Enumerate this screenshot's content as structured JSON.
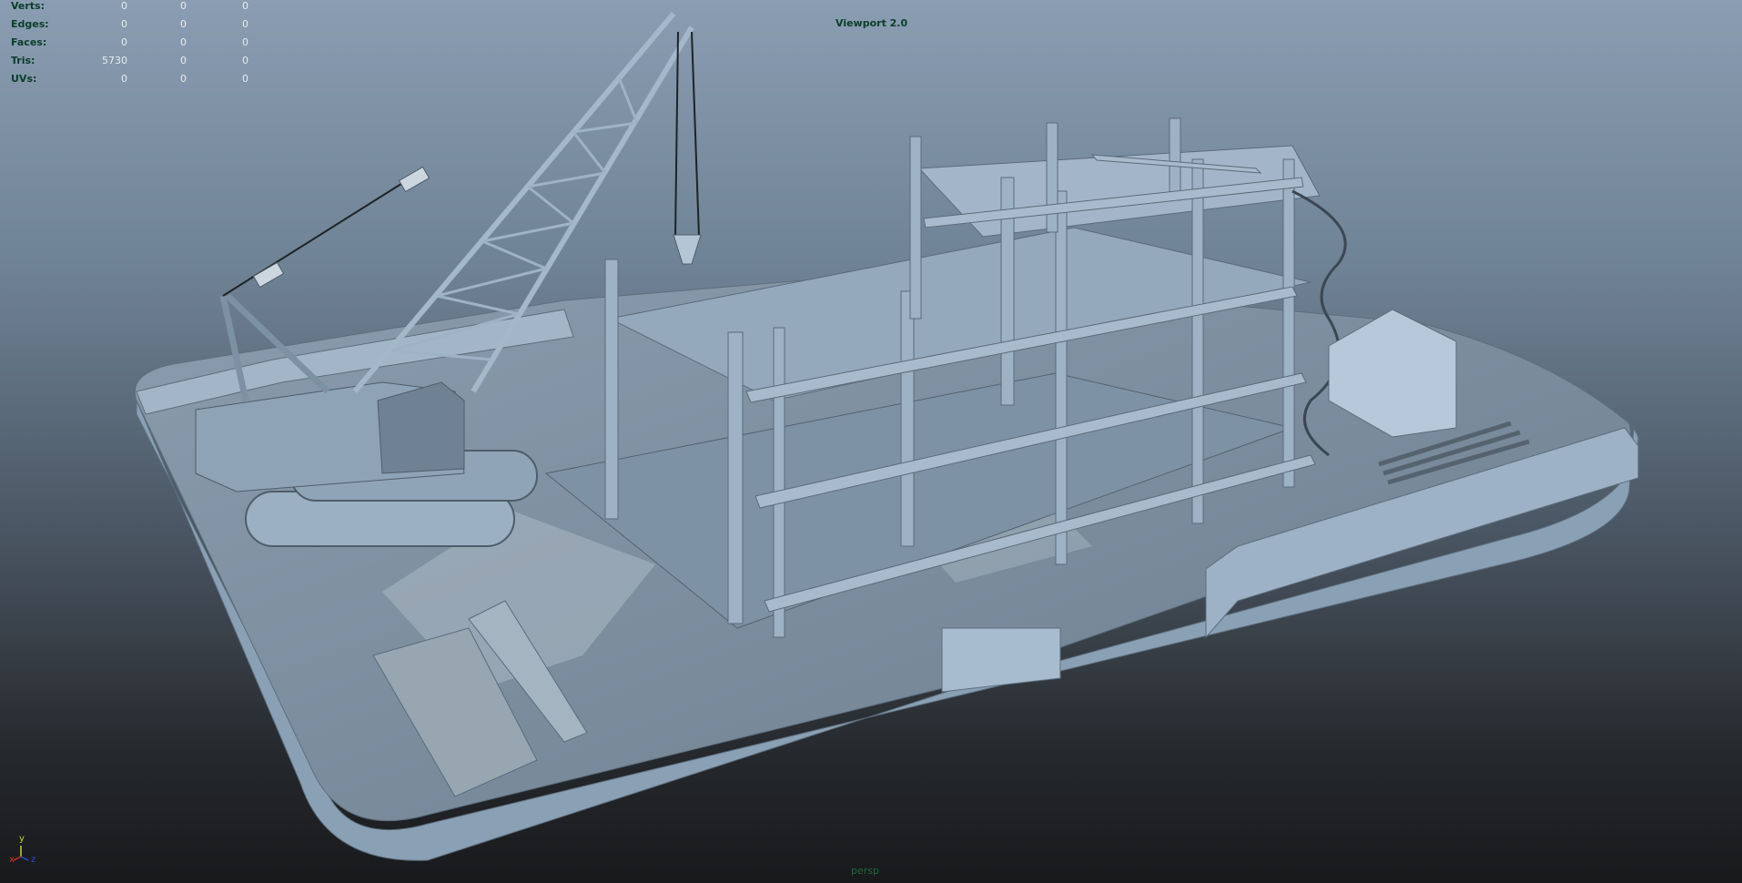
{
  "viewport": {
    "title": "Viewport 2.0",
    "camera": "persp"
  },
  "hud": {
    "rows": [
      {
        "label": "Verts:",
        "v1": "0",
        "v2": "0",
        "v3": "0"
      },
      {
        "label": "Edges:",
        "v1": "0",
        "v2": "0",
        "v3": "0"
      },
      {
        "label": "Faces:",
        "v1": "0",
        "v2": "0",
        "v3": "0"
      },
      {
        "label": "Tris:",
        "v1": "5730",
        "v2": "0",
        "v3": "0"
      },
      {
        "label": "UVs:",
        "v1": "0",
        "v2": "0",
        "v3": "0"
      }
    ]
  },
  "axis": {
    "x": "x",
    "y": "y",
    "z": "z",
    "x_color": "#d0302a",
    "y_color": "#c8d23a",
    "z_color": "#2a4fd0"
  },
  "colors": {
    "hud_label": "#0b3d2a",
    "model_light": "#9fb4c8",
    "model_mid": "#7f94a8",
    "model_dark": "#54636f"
  }
}
